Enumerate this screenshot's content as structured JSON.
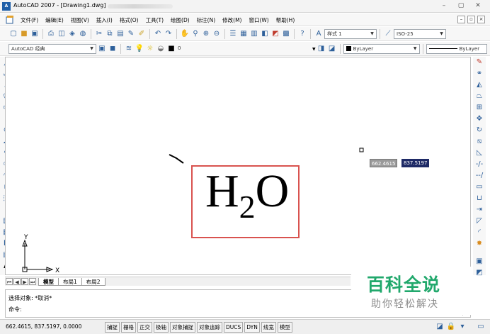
{
  "window": {
    "app_icon": "A",
    "title": "AutoCAD 2007 - [Drawing1.dwg]",
    "controls": [
      "–",
      "▢",
      "✕"
    ]
  },
  "menubar": {
    "items": [
      "文件(F)",
      "编辑(E)",
      "视图(V)",
      "插入(I)",
      "格式(O)",
      "工具(T)",
      "绘图(D)",
      "标注(N)",
      "修改(M)",
      "窗口(W)",
      "帮助(H)"
    ],
    "doc_controls": [
      "–",
      "▫",
      "×"
    ]
  },
  "toolbar1": {
    "text_style_value": "样式 1",
    "dim_style_value": "ISO-25"
  },
  "toolbar2": {
    "workspace_value": "AutoCAD 经典",
    "layer_value": "0",
    "color_value": "ByLayer",
    "linetype_value": "ByLayer"
  },
  "canvas": {
    "dyn_x": "662.4615",
    "dyn_y": "837.5197",
    "ucs_x": "X",
    "ucs_y": "Y",
    "text_main": "H",
    "text_sub": "2",
    "text_tail": "O",
    "text_box_color": "#d9534f"
  },
  "layout_tabs": [
    "模型",
    "布局1",
    "布局2"
  ],
  "command": {
    "line1": "选择对象: *取消*",
    "line2": "命令:"
  },
  "statusbar": {
    "coords": "662.4615, 837.5197, 0.0000",
    "toggles": [
      "捕捉",
      "栅格",
      "正交",
      "极轴",
      "对象捕捉",
      "对象追踪",
      "DUCS",
      "DYN",
      "线宽",
      "模型"
    ]
  },
  "watermark": {
    "main": "百科全说",
    "sub": "助你轻松解决"
  },
  "colors": {
    "accent_blue": "#1f5fa8",
    "watermark_green": "#21a86c"
  }
}
